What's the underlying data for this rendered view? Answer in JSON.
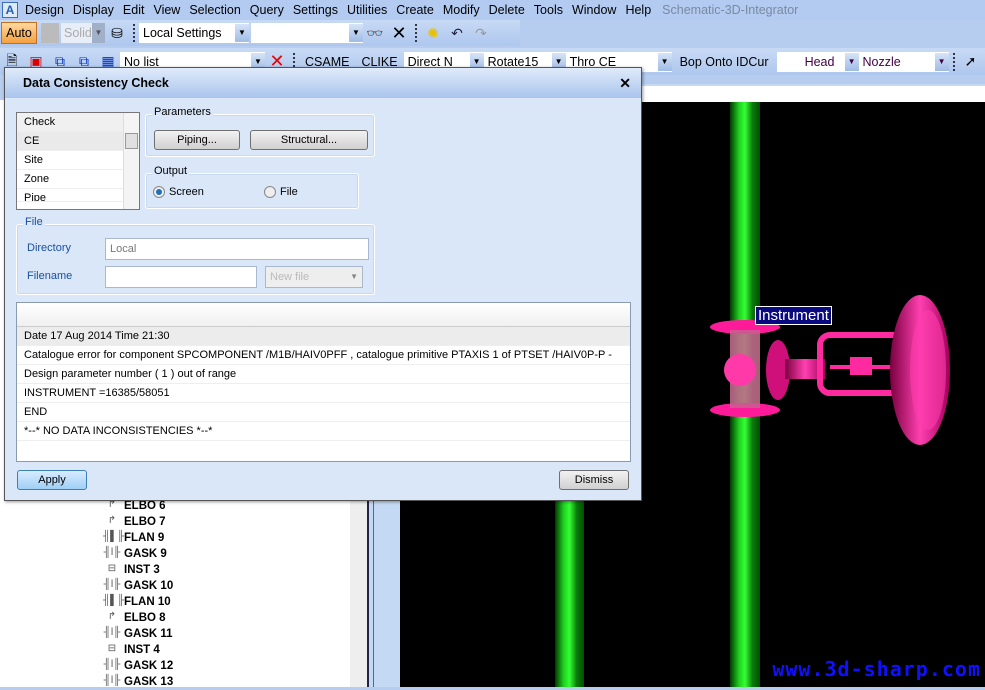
{
  "app": {
    "title": "Schematic-3D-Integrator"
  },
  "menu": [
    "Design",
    "Display",
    "Edit",
    "View",
    "Selection",
    "Query",
    "Settings",
    "Utilities",
    "Create",
    "Modify",
    "Delete",
    "Tools",
    "Window",
    "Help"
  ],
  "toolbar1": {
    "auto": "Auto",
    "solid": "Solid",
    "settings": "Local Settings",
    "settings2": ""
  },
  "toolbar2": {
    "list": "No list",
    "csame": "CSAME",
    "clike": "CLIKE",
    "direction": "Direct N",
    "rotate": "Rotate15",
    "thro": "Thro CE",
    "bop": "Bop Onto IDCur",
    "head": "Head",
    "nozzle": "Nozzle"
  },
  "dialog": {
    "title": "Data Consistency Check",
    "check_list": [
      "Check",
      "CE",
      "Site",
      "Zone",
      "Pipe"
    ],
    "parameters_label": "Parameters",
    "piping": "Piping...",
    "structural": "Structural...",
    "output_label": "Output",
    "screen": "Screen",
    "file": "File",
    "output_selected": "Screen",
    "file_label": "File",
    "directory_label": "Directory",
    "directory_value": "Local",
    "filename_label": "Filename",
    "filename_value": "",
    "newfile": "New file",
    "output_lines": [
      "Date 17 Aug 2014 Time 21:30",
      "Catalogue error for component SPCOMPONENT /M1B/HAIV0PFF , catalogue primitive PTAXIS 1 of PTSET /HAIV0P-P -",
      "Design parameter number ( 1 ) out of range",
      "INSTRUMENT =16385/58051",
      "END",
      "*--* NO DATA INCONSISTENCIES *--*"
    ],
    "apply": "Apply",
    "dismiss": "Dismiss"
  },
  "tree": [
    {
      "icon": "elbow-icon",
      "label": "ELBO 6"
    },
    {
      "icon": "elbow-icon",
      "label": "ELBO 7"
    },
    {
      "icon": "flange-icon",
      "label": "FLAN 9"
    },
    {
      "icon": "gasket-icon",
      "label": "GASK 9"
    },
    {
      "icon": "instrument-icon",
      "label": "INST 3"
    },
    {
      "icon": "gasket-icon",
      "label": "GASK 10"
    },
    {
      "icon": "flange-icon",
      "label": "FLAN 10"
    },
    {
      "icon": "elbow-icon",
      "label": "ELBO 8"
    },
    {
      "icon": "gasket-icon",
      "label": "GASK 11"
    },
    {
      "icon": "instrument-icon",
      "label": "INST 4"
    },
    {
      "icon": "gasket-icon",
      "label": "GASK 12"
    },
    {
      "icon": "gasket-icon",
      "label": "GASK 13"
    }
  ],
  "viewport": {
    "tag": "Instrument",
    "watermark": "www.3d-sharp.com",
    "pipe_color": "#22ff22",
    "instrument_color": "#ff2aa0"
  }
}
